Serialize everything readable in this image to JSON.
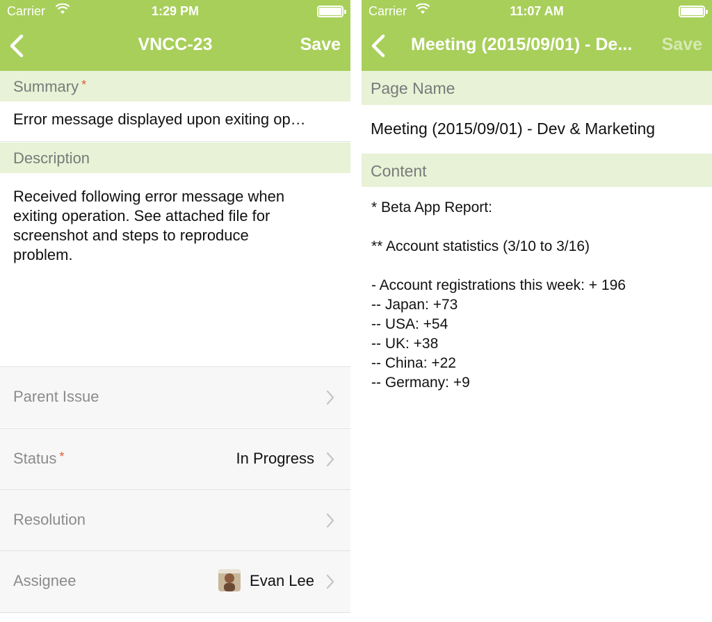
{
  "left": {
    "status_bar": {
      "carrier": "Carrier",
      "time": "1:29 PM"
    },
    "nav": {
      "title": "VNCC-23",
      "save_label": "Save"
    },
    "summary": {
      "label": "Summary",
      "required_mark": "*",
      "value": "Error message displayed upon exiting op…"
    },
    "description": {
      "label": "Description",
      "lines": [
        "Received following error message when",
        "exiting operation. See attached file for",
        "screenshot and steps to reproduce",
        "problem."
      ]
    },
    "rows": [
      {
        "label": "Parent Issue",
        "required_mark": "",
        "value": ""
      },
      {
        "label": "Status",
        "required_mark": "*",
        "value": "In Progress"
      },
      {
        "label": "Resolution",
        "required_mark": "",
        "value": ""
      },
      {
        "label": "Assignee",
        "required_mark": "",
        "value": "Evan Lee"
      }
    ]
  },
  "right": {
    "status_bar": {
      "carrier": "Carrier",
      "time": "11:07 AM"
    },
    "nav": {
      "title": "Meeting (2015/09/01) - De...",
      "save_label": "Save"
    },
    "page_name": {
      "label": "Page Name",
      "value": "Meeting (2015/09/01) - Dev & Marketing"
    },
    "content": {
      "label": "Content",
      "lines": [
        "* Beta App Report:",
        "** Account statistics (3/10 to 3/16)",
        "- Account registrations this week: + 196",
        "-- Japan: +73",
        "-- USA: +54",
        "-- UK: +38",
        "-- China: +22",
        "-- Germany: +9"
      ]
    }
  },
  "colors": {
    "accent": "#a8cf5a",
    "section_bg": "#e7f2d6",
    "required": "#e05a3a"
  }
}
